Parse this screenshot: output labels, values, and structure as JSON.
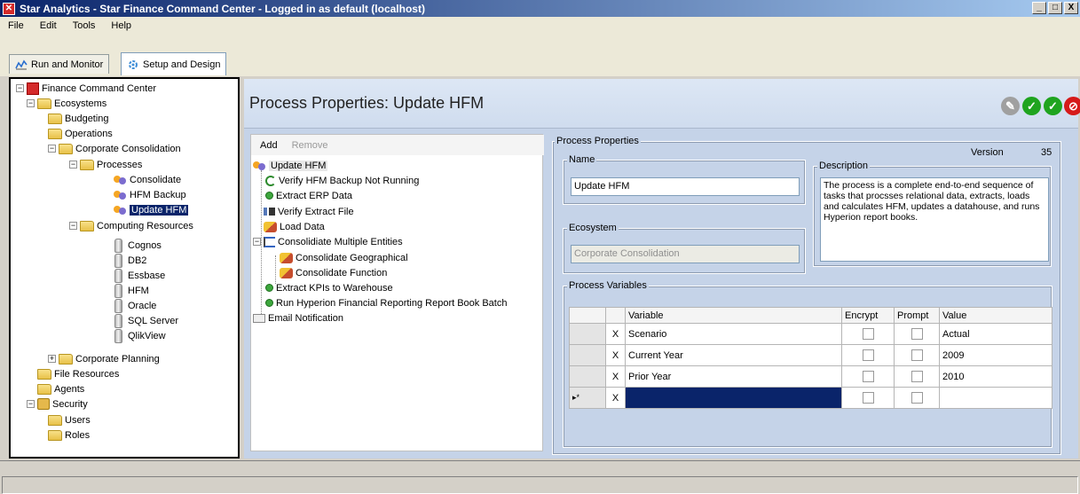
{
  "window": {
    "title": "Star Analytics - Star Finance Command Center - Logged in as default (localhost)",
    "controls": {
      "minimize": "_",
      "maximize": "□",
      "close": "X"
    }
  },
  "menu": [
    "File",
    "Edit",
    "Tools",
    "Help"
  ],
  "tabs": [
    {
      "label": "Run and Monitor",
      "icon": "monitor-icon",
      "active": false
    },
    {
      "label": "Setup and Design",
      "icon": "setup-icon",
      "active": true
    }
  ],
  "sidebar": {
    "root": "Finance Command Center",
    "ecosystems": "Ecosystems",
    "budgeting": "Budgeting",
    "operations": "Operations",
    "corporate_consolidation": "Corporate Consolidation",
    "processes": "Processes",
    "process_items": [
      "Consolidate",
      "HFM Backup",
      "Update HFM"
    ],
    "computing_resources": "Computing Resources",
    "resources": [
      "Cognos",
      "DB2",
      "Essbase",
      "HFM",
      "Oracle",
      "SQL Server",
      "QlikView"
    ],
    "corporate_planning": "Corporate Planning",
    "file_resources": "File Resources",
    "agents": "Agents",
    "security": "Security",
    "users": "Users",
    "roles": "Roles",
    "expand_minus": "−",
    "expand_plus": "+"
  },
  "header": {
    "title": "Process Properties: Update HFM",
    "colors": {
      "disabled": "#a0a0a0",
      "green": "#1fa41f",
      "red": "#d61a1a"
    }
  },
  "process_tree": {
    "add_label": "Add",
    "remove_label": "Remove",
    "root": "Update HFM",
    "steps": [
      "Verify HFM Backup Not Running",
      "Extract ERP Data",
      "Verify Extract File",
      "Load Data",
      "Consolidiate Multiple Entities",
      "Consolidate Geographical",
      "Consolidate Function",
      "Extract KPIs to Warehouse",
      "Run Hyperion Financial Reporting Report Book Batch",
      "Email Notification"
    ]
  },
  "properties": {
    "legend": "Process Properties",
    "version_label": "Version",
    "version_value": "35",
    "name_legend": "Name",
    "name_value": "Update HFM",
    "description_legend": "Description",
    "description_value": "The process is a complete end-to-end sequence of tasks that procsses relational data, extracts, loads and calculates HFM, updates a datahouse, and runs Hyperion report books.",
    "ecosystem_legend": "Ecosystem",
    "ecosystem_value": "Corporate Consolidation"
  },
  "variables": {
    "legend": "Process Variables",
    "columns": [
      "Variable",
      "Encrypt",
      "Prompt",
      "Value"
    ],
    "rows": [
      {
        "x": "X",
        "variable": "Scenario",
        "value": "Actual"
      },
      {
        "x": "X",
        "variable": "Current Year",
        "value": "2009"
      },
      {
        "x": "X",
        "variable": "Prior Year",
        "value": "2010"
      }
    ],
    "new_row": {
      "marker": "▸*",
      "x": "X"
    }
  }
}
